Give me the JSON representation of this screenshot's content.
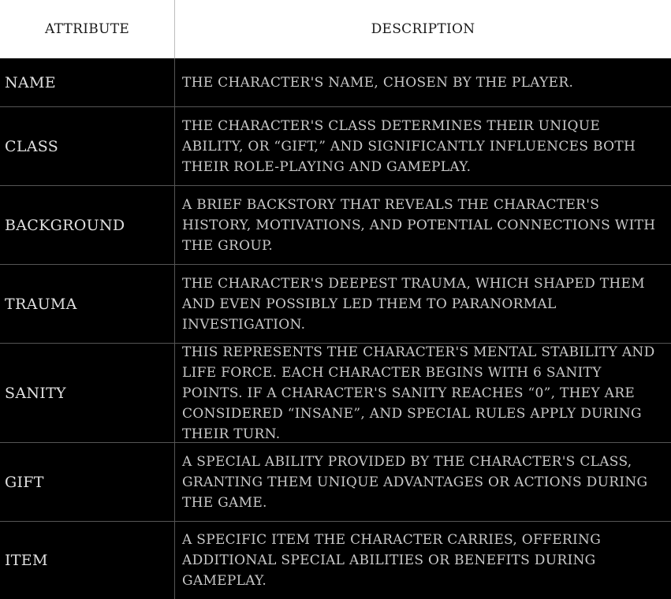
{
  "header": {
    "attribute_label": "Attribute",
    "description_label": "Description"
  },
  "rows": [
    {
      "attribute": "Name",
      "description": "The character's name, chosen by the player."
    },
    {
      "attribute": "Class",
      "description": "The character's class determines their unique ability, or “gift,” and significantly influences both their role-playing and gameplay."
    },
    {
      "attribute": "Background",
      "description": "A brief backstory that reveals the character's history, motivations, and potential connections with the group."
    },
    {
      "attribute": "Trauma",
      "description": "The character's deepest trauma, which shaped them and even possibly led them to paranormal investigation."
    },
    {
      "attribute": "Sanity",
      "description": "This represents the character's mental stability and life force. Each character begins with 6 Sanity points. If a character's Sanity reaches “0”, they are considered “insane”, and special rules apply during their turn."
    },
    {
      "attribute": "Gift",
      "description": "A special ability provided by the character's class, granting them unique advantages or actions during the game."
    },
    {
      "attribute": "Item",
      "description": "A specific item the character carries, offering additional special abilities or benefits during gameplay."
    }
  ]
}
